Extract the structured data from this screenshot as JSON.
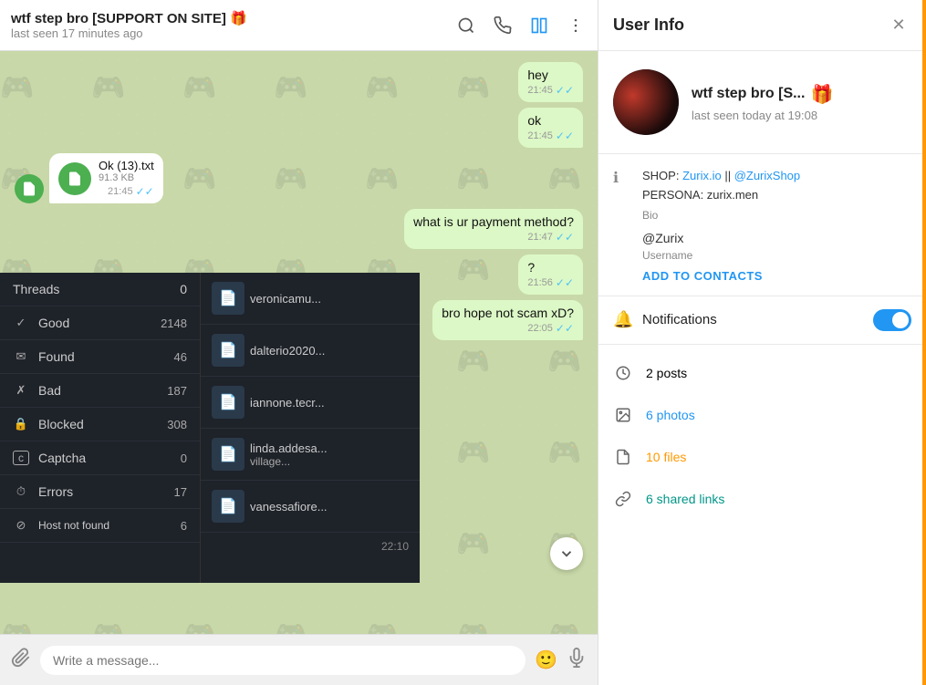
{
  "chat": {
    "title": "wtf step bro [SUPPORT ON SITE] 🎁",
    "subtitle": "last seen 17 minutes ago",
    "messages": [
      {
        "id": 1,
        "type": "sent",
        "text": "hey",
        "time": "21:45",
        "read": true
      },
      {
        "id": 2,
        "type": "sent",
        "text": "ok",
        "time": "21:45",
        "read": true
      },
      {
        "id": 3,
        "type": "received",
        "isFile": true,
        "fileName": "Ok (13).txt",
        "fileSize": "91.3 KB",
        "time": "21:45",
        "read": true
      },
      {
        "id": 4,
        "type": "sent",
        "text": "what is ur payment method?",
        "time": "21:47",
        "read": true
      },
      {
        "id": 5,
        "type": "sent",
        "text": "?",
        "time": "21:56",
        "read": true
      },
      {
        "id": 6,
        "type": "sent",
        "text": "bro hope not scam xD?",
        "time": "22:05",
        "read": true
      }
    ],
    "input_placeholder": "Write a message...",
    "last_time": "22:10"
  },
  "overlay": {
    "threads_label": "Threads",
    "threads_count": "0",
    "items": [
      {
        "icon": "✓",
        "label": "Good",
        "count": "2148"
      },
      {
        "icon": "✉",
        "label": "Found",
        "count": "46"
      },
      {
        "icon": "✗",
        "label": "Bad",
        "count": "187"
      },
      {
        "icon": "🔒",
        "label": "Blocked",
        "count": "308"
      },
      {
        "icon": "©",
        "label": "Captcha",
        "count": "0"
      },
      {
        "icon": "⏱",
        "label": "Errors",
        "count": "17"
      },
      {
        "icon": "⊘",
        "label": "Host not found",
        "count": "6"
      }
    ],
    "right_items": [
      {
        "name": "veronicamu..."
      },
      {
        "name": "dalterio2020..."
      },
      {
        "name": "iannone.tecr..."
      },
      {
        "name": "linda.addesa..."
      },
      {
        "name": "vanessafiore..."
      }
    ]
  },
  "userInfo": {
    "panel_title": "User Info",
    "username_display": "wtf step bro [S...",
    "status": "last seen today at 19:08",
    "bio_line1": "SHOP: ",
    "bio_link1": "Zurix.io",
    "bio_separator": " || ",
    "bio_link2": "@ZurixShop",
    "bio_line2": "PERSONA: zurix.men",
    "bio_label": "Bio",
    "username": "@Zurix",
    "username_label": "Username",
    "add_to_contacts": "ADD TO CONTACTS",
    "notifications_label": "Notifications",
    "posts_label": "2 posts",
    "photos_label": "6 photos",
    "files_label": "10 files",
    "links_label": "6 shared links"
  }
}
